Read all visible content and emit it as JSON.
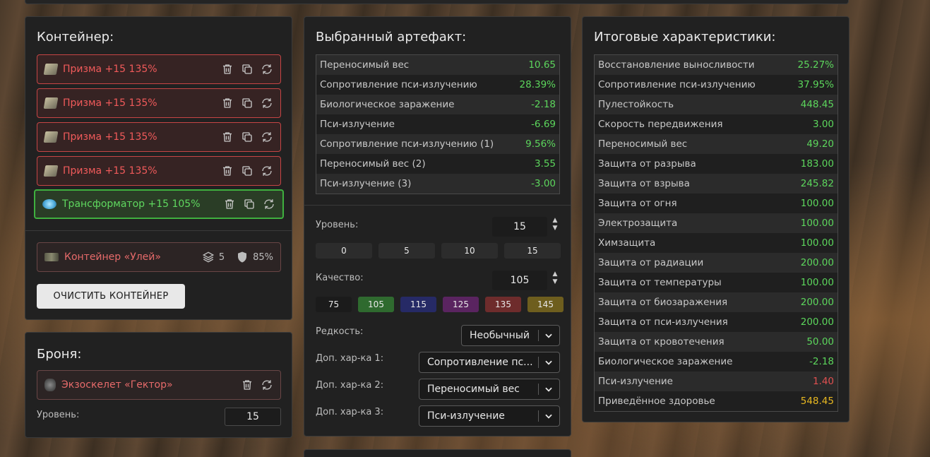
{
  "container": {
    "title": "Контейнер:",
    "items": [
      {
        "label": "Призма +15 135%",
        "variant": "red",
        "icon": "prism-icon"
      },
      {
        "label": "Призма +15 135%",
        "variant": "red",
        "icon": "prism-icon"
      },
      {
        "label": "Призма +15 135%",
        "variant": "red",
        "icon": "prism-icon"
      },
      {
        "label": "Призма +15 135%",
        "variant": "red",
        "icon": "prism-icon"
      },
      {
        "label": "Трансформатор +15 105%",
        "variant": "green",
        "icon": "transformer-icon"
      }
    ],
    "hive": {
      "label": "Контейнер «Улей»",
      "slots": "5",
      "protection": "85%"
    },
    "clear_label": "ОЧИСТИТЬ КОНТЕЙНЕР"
  },
  "armor": {
    "title": "Броня:",
    "item_label": "Экзоскелет «Гектор»",
    "level_label": "Уровень:",
    "level_value": "15"
  },
  "artifact": {
    "title": "Выбранный артефакт:",
    "stats": [
      {
        "name": "Переносимый вес",
        "value": "10.65",
        "color": "green"
      },
      {
        "name": "Сопротивление пси-излучению",
        "value": "28.39%",
        "color": "green"
      },
      {
        "name": "Биологическое заражение",
        "value": "-2.18",
        "color": "green"
      },
      {
        "name": "Пси-излучение",
        "value": "-6.69",
        "color": "green"
      },
      {
        "name": "Сопротивление пси-излучению (1)",
        "value": "9.56%",
        "color": "green"
      },
      {
        "name": "Переносимый вес (2)",
        "value": "3.55",
        "color": "green"
      },
      {
        "name": "Пси-излучение (3)",
        "value": "-3.00",
        "color": "green"
      }
    ],
    "level_label": "Уровень:",
    "level_value": "15",
    "level_presets": [
      "0",
      "5",
      "10",
      "15"
    ],
    "quality_label": "Качество:",
    "quality_value": "105",
    "quality_presets": [
      {
        "label": "75",
        "color": "#1b1b1b"
      },
      {
        "label": "105",
        "color": "#2f6a2f"
      },
      {
        "label": "115",
        "color": "#262a66"
      },
      {
        "label": "125",
        "color": "#5a2460"
      },
      {
        "label": "135",
        "color": "#6e2c2c"
      },
      {
        "label": "145",
        "color": "#6e5e1e"
      }
    ],
    "rarity_label": "Редкость:",
    "rarity_value": "Необычный",
    "extra1_label": "Доп. хар-ка 1:",
    "extra1_value": "Сопротивление пс...",
    "extra2_label": "Доп. хар-ка 2:",
    "extra2_value": "Переносимый вес",
    "extra3_label": "Доп. хар-ка 3:",
    "extra3_value": "Пси-излучение"
  },
  "totals": {
    "title": "Итоговые характеристики:",
    "stats": [
      {
        "name": "Восстановление выносливости",
        "value": "25.27%",
        "color": "green"
      },
      {
        "name": "Сопротивление пси-излучению",
        "value": "37.95%",
        "color": "green"
      },
      {
        "name": "Пулестойкость",
        "value": "448.45",
        "color": "green"
      },
      {
        "name": "Скорость передвижения",
        "value": "3.00",
        "color": "green"
      },
      {
        "name": "Переносимый вес",
        "value": "49.20",
        "color": "green"
      },
      {
        "name": "Защита от разрыва",
        "value": "183.00",
        "color": "green"
      },
      {
        "name": "Защита от взрыва",
        "value": "245.82",
        "color": "green"
      },
      {
        "name": "Защита от огня",
        "value": "100.00",
        "color": "green"
      },
      {
        "name": "Электрозащита",
        "value": "100.00",
        "color": "green"
      },
      {
        "name": "Химзащита",
        "value": "100.00",
        "color": "green"
      },
      {
        "name": "Защита от радиации",
        "value": "200.00",
        "color": "green"
      },
      {
        "name": "Защита от температуры",
        "value": "100.00",
        "color": "green"
      },
      {
        "name": "Защита от биозаражения",
        "value": "200.00",
        "color": "green"
      },
      {
        "name": "Защита от пси-излучения",
        "value": "200.00",
        "color": "green"
      },
      {
        "name": "Защита от кровотечения",
        "value": "50.00",
        "color": "green"
      },
      {
        "name": "Биологическое заражение",
        "value": "-2.18",
        "color": "green"
      },
      {
        "name": "Пси-излучение",
        "value": "1.40",
        "color": "red"
      },
      {
        "name": "Приведённое здоровье",
        "value": "548.45",
        "color": "gold"
      }
    ]
  }
}
